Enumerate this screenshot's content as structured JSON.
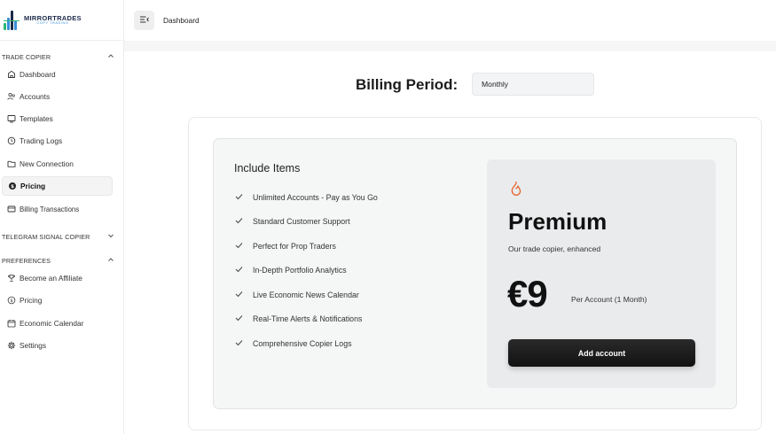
{
  "brand": {
    "title": "MIRRORTRADES",
    "subtitle": "COPY TRADING",
    "colors": {
      "dark": "#1b2a4a",
      "accent": "#3a8fd8",
      "green": "#2bb673"
    }
  },
  "sidebar": {
    "sections": [
      {
        "label": "TRADE COPIER",
        "chevron": "⌃"
      },
      {
        "label": "TELEGRAM SIGNAL COPIER",
        "chevron": "⌄"
      },
      {
        "label": "PREFERENCES",
        "chevron": "⌃"
      }
    ],
    "items": [
      {
        "label": "Dashboard",
        "icon": "home-icon"
      },
      {
        "label": "Accounts",
        "icon": "users-icon"
      },
      {
        "label": "Templates",
        "icon": "monitor-icon"
      },
      {
        "label": "Trading Logs",
        "icon": "history-icon"
      },
      {
        "label": "New Connection",
        "icon": "folder-icon"
      },
      {
        "label": "Pricing",
        "icon": "coin-icon"
      },
      {
        "label": "Billing Transactions",
        "icon": "card-icon"
      },
      {
        "label": "Become an Affiliate",
        "icon": "trophy-icon"
      },
      {
        "label": "Pricing",
        "icon": "dollar-circle-icon"
      },
      {
        "label": "Economic Calendar",
        "icon": "calendar-icon"
      },
      {
        "label": "Settings",
        "icon": "gear-icon"
      }
    ]
  },
  "topbar": {
    "breadcrumb": "Dashboard"
  },
  "billing": {
    "label": "Billing Period:",
    "selected": "Monthly"
  },
  "include": {
    "title": "Include Items",
    "features": [
      "Unlimited Accounts - Pay as You Go",
      "Standard Customer Support",
      "Perfect for Prop Traders",
      "In-Depth Portfolio Analytics",
      "Live Economic News Calendar",
      "Real-Time Alerts & Notifications",
      "Comprehensive Copier Logs"
    ]
  },
  "plan": {
    "name": "Premium",
    "description": "Our trade copier, enhanced",
    "price": "€9",
    "price_note": "Per Account (1 Month)",
    "button": "Add account",
    "icon": "flame-icon",
    "icon_color": "#e8622a"
  }
}
